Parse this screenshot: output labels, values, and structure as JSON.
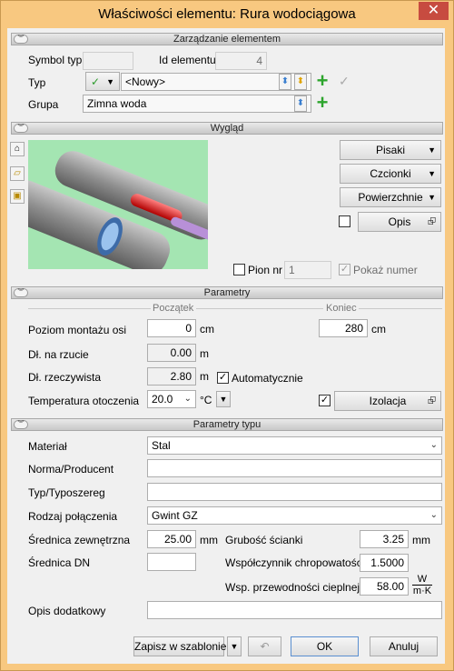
{
  "window": {
    "title": "Właściwości elementu: Rura wodociągowa",
    "close": "✕"
  },
  "sections": {
    "zarzadzanie": "Zarządzanie elementem",
    "wyglad": "Wygląd",
    "parametry": "Parametry",
    "parametry_typu": "Parametry typu"
  },
  "mgmt": {
    "symbol_label": "Symbol typu",
    "symbol_value": "",
    "id_label": "Id elementu",
    "id_value": "4",
    "typ_label": "Typ",
    "typ_check": "✓",
    "typ_value": "<Nowy>",
    "grupa_label": "Grupa",
    "grupa_value": "Zimna woda"
  },
  "look": {
    "pisaki": "Pisaki",
    "czcionki": "Czcionki",
    "powierzchnie": "Powierzchnie",
    "opis": "Opis",
    "pion_label": "Pion nr",
    "pion_value": "1",
    "pokaz_label": "Pokaż numer",
    "pokaz_check": "✓"
  },
  "params": {
    "poczatek": "Początek",
    "koniec": "Koniec",
    "poziom_label": "Poziom montażu osi",
    "poziom_start": "0",
    "poziom_end": "280",
    "unit_cm": "cm",
    "rzut_label": "Dł. na rzucie",
    "rzut_value": "0.00",
    "unit_m": "m",
    "rzecz_label": "Dł. rzeczywista",
    "rzecz_value": "2.80",
    "auto_label": "Automatycznie",
    "auto_check": "✓",
    "temp_label": "Temperatura otoczenia",
    "temp_value": "20.0",
    "unit_c": "°C",
    "izol_check": "✓",
    "izolacja": "Izolacja"
  },
  "typeparams": {
    "material_label": "Materiał",
    "material_value": "Stal",
    "norma_label": "Norma/Producent",
    "norma_value": "",
    "typosz_label": "Typ/Typoszereg",
    "typosz_value": "",
    "rodzaj_label": "Rodzaj połączenia",
    "rodzaj_value": "Gwint GZ",
    "srz_label": "Średnica zewnętrzna",
    "srz_value": "25.00",
    "unit_mm": "mm",
    "grub_label": "Grubość ścianki",
    "grub_value": "3.25",
    "sdn_label": "Średnica DN",
    "sdn_value": "",
    "chrop_label": "Współczynnik chropowatości",
    "chrop_value": "1.5000",
    "przew_label": "Wsp. przewodności cieplnej",
    "przew_value": "58.00",
    "unit_w_top": "W",
    "unit_w_bot": "m·K",
    "opis_label": "Opis dodatkowy",
    "opis_value": ""
  },
  "footer": {
    "zapisz": "Zapisz w szablonie",
    "ok": "OK",
    "anuluj": "Anuluj"
  },
  "colors": {
    "titlebar": "#f8c880",
    "close": "#c74b40",
    "plus": "#2da52d",
    "preview_bg": "#9ee2ac"
  }
}
